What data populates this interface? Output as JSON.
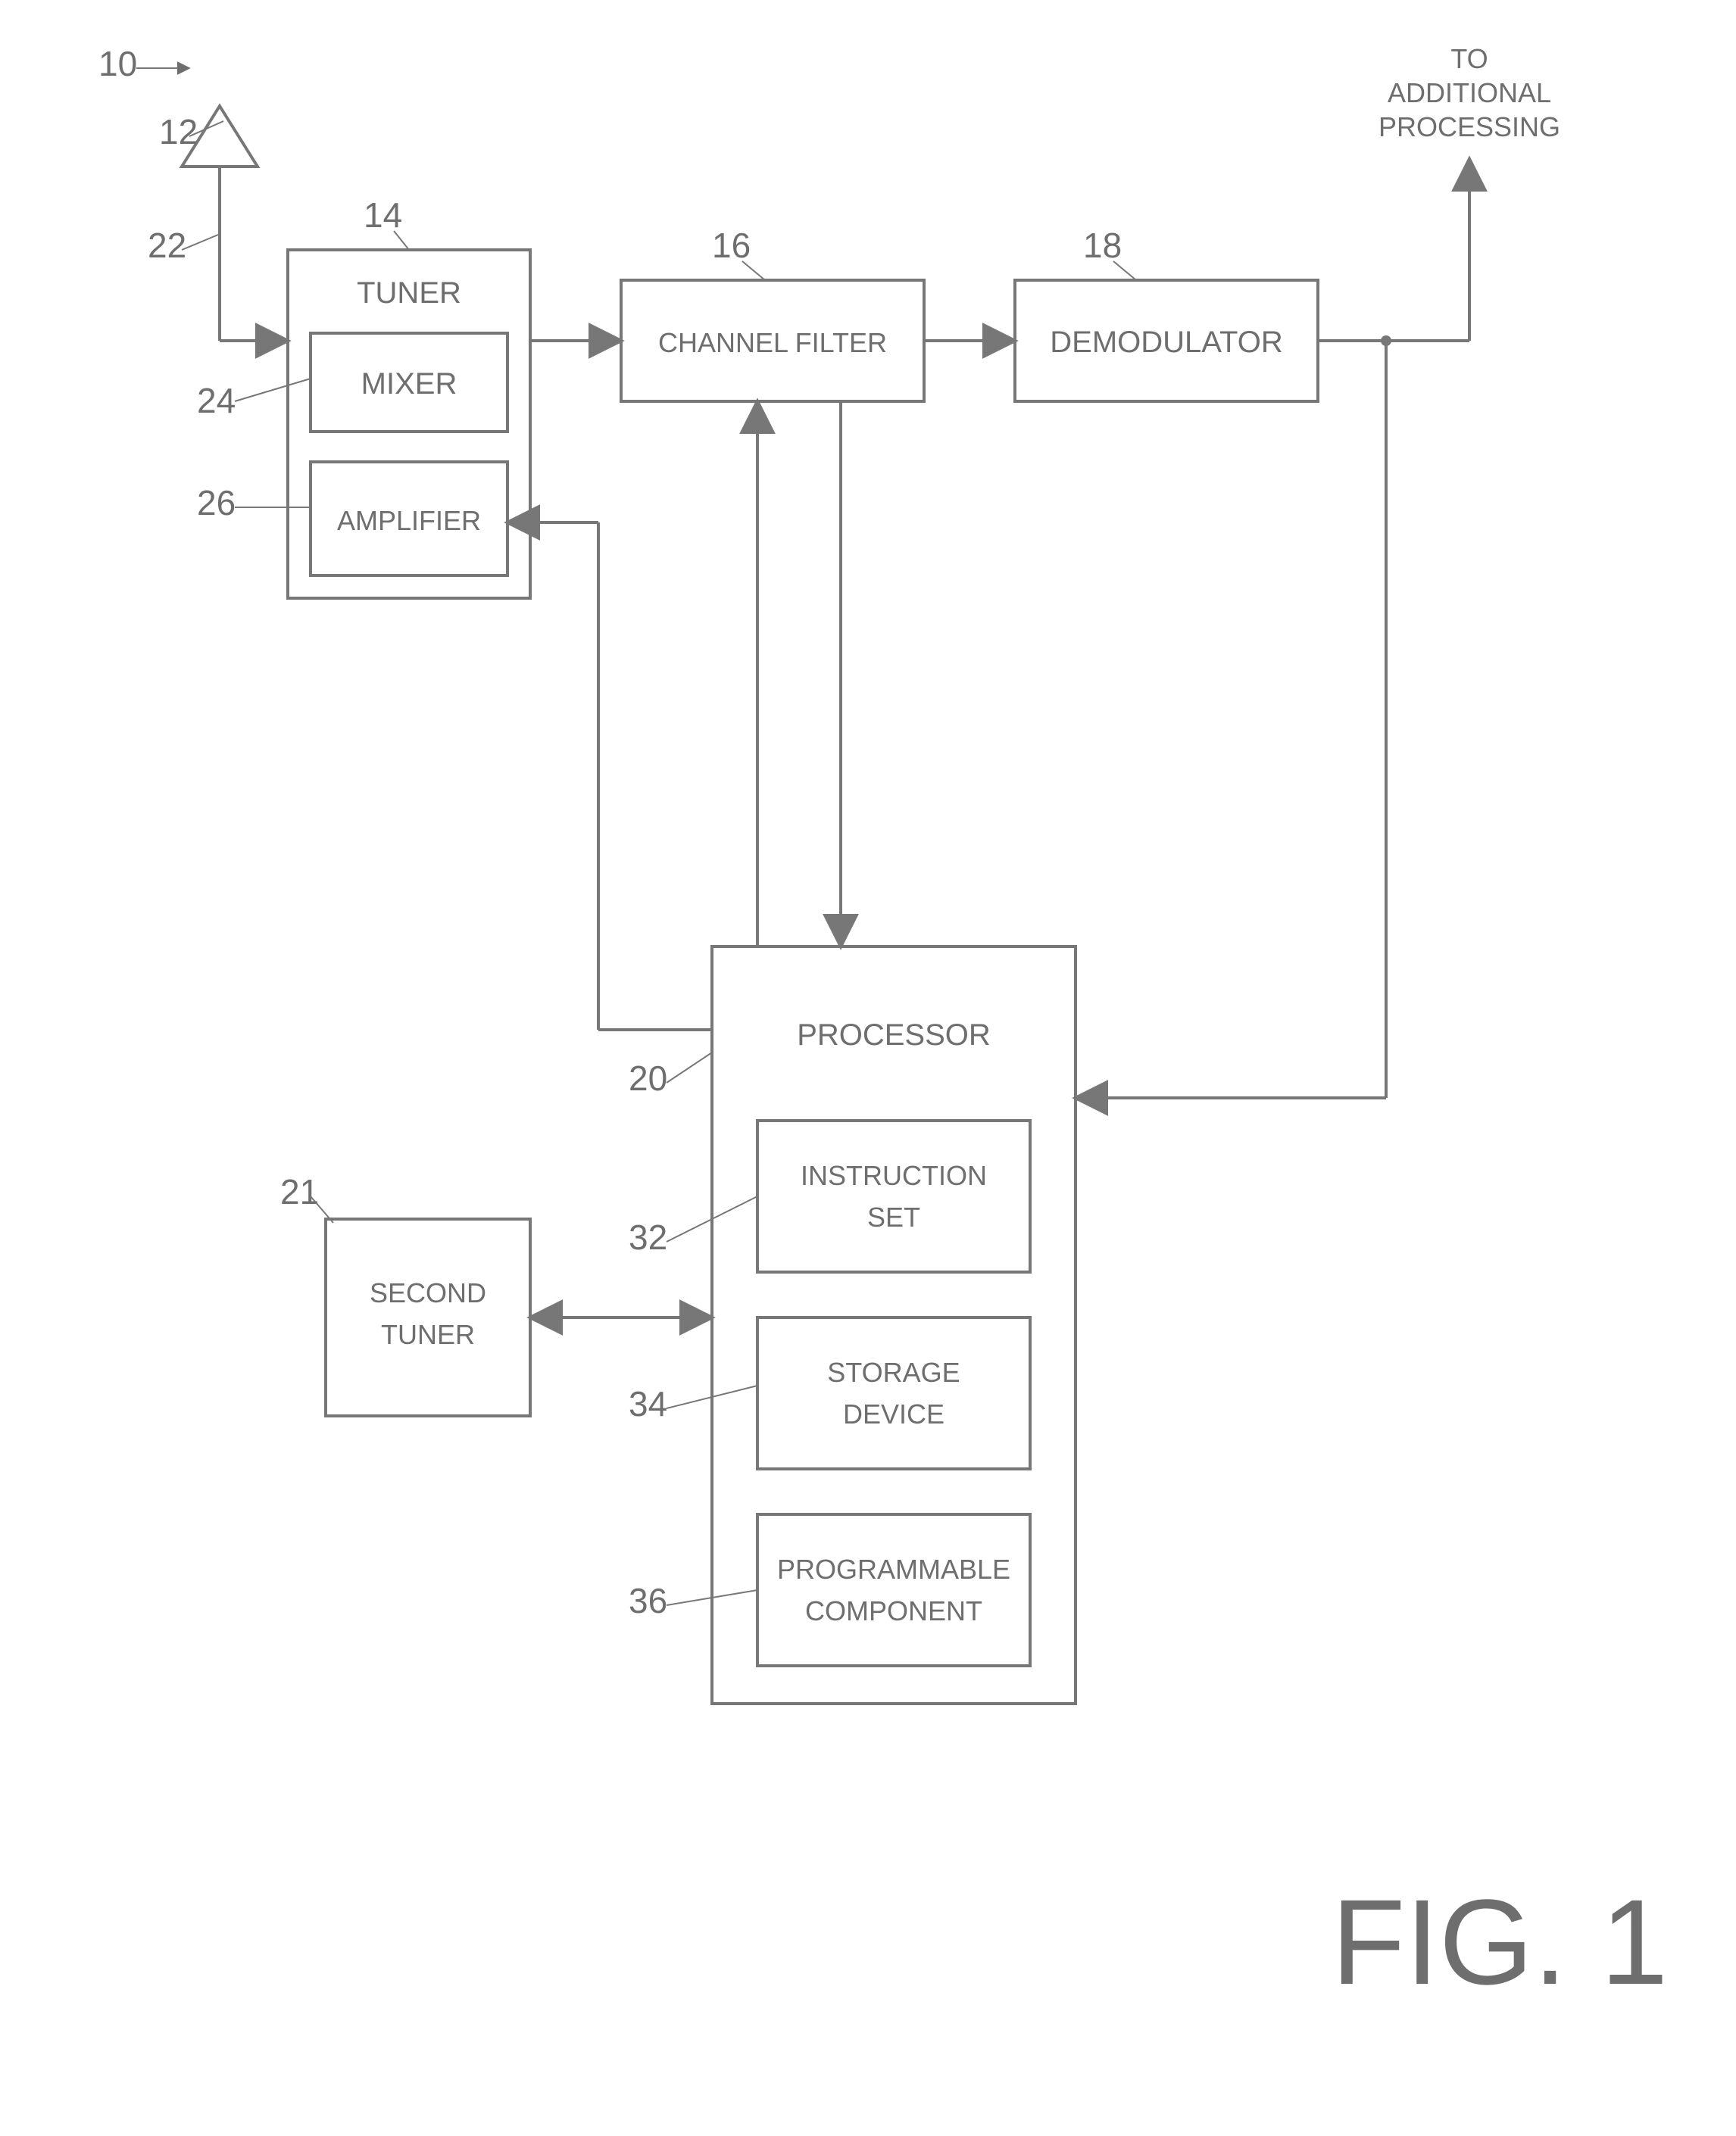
{
  "figure_label": "FIG. 1",
  "output_label_line1": "TO",
  "output_label_line2": "ADDITIONAL",
  "output_label_line3": "PROCESSING",
  "blocks": {
    "tuner": "TUNER",
    "mixer": "MIXER",
    "amplifier": "AMPLIFIER",
    "channel_filter": "CHANNEL FILTER",
    "demodulator": "DEMODULATOR",
    "processor": "PROCESSOR",
    "instruction_set_line1": "INSTRUCTION",
    "instruction_set_line2": "SET",
    "storage_line1": "STORAGE",
    "storage_line2": "DEVICE",
    "programmable_line1": "PROGRAMMABLE",
    "programmable_line2": "COMPONENT",
    "second_tuner_line1": "SECOND",
    "second_tuner_line2": "TUNER"
  },
  "refs": {
    "r10": "10",
    "r12": "12",
    "r14": "14",
    "r16": "16",
    "r18": "18",
    "r20": "20",
    "r21": "21",
    "r22": "22",
    "r24": "24",
    "r26": "26",
    "r32": "32",
    "r34": "34",
    "r36": "36"
  },
  "chart_data": {
    "type": "block-diagram",
    "nodes": [
      {
        "id": 10,
        "label": "(overall system)"
      },
      {
        "id": 12,
        "label": "(antenna)"
      },
      {
        "id": 14,
        "label": "TUNER",
        "contains": [
          24,
          26
        ]
      },
      {
        "id": 24,
        "label": "MIXER"
      },
      {
        "id": 26,
        "label": "AMPLIFIER"
      },
      {
        "id": 16,
        "label": "CHANNEL FILTER"
      },
      {
        "id": 18,
        "label": "DEMODULATOR"
      },
      {
        "id": 20,
        "label": "PROCESSOR",
        "contains": [
          32,
          34,
          36
        ]
      },
      {
        "id": 32,
        "label": "INSTRUCTION SET"
      },
      {
        "id": 34,
        "label": "STORAGE DEVICE"
      },
      {
        "id": 36,
        "label": "PROGRAMMABLE COMPONENT"
      },
      {
        "id": 21,
        "label": "SECOND TUNER"
      },
      {
        "id": "out",
        "label": "TO ADDITIONAL PROCESSING"
      }
    ],
    "edges": [
      {
        "from": 12,
        "to": 14,
        "dir": "uni"
      },
      {
        "from": 14,
        "to": 16,
        "dir": "uni"
      },
      {
        "from": 16,
        "to": 18,
        "dir": "uni"
      },
      {
        "from": 18,
        "to": "out",
        "dir": "uni"
      },
      {
        "from": 16,
        "to": 20,
        "dir": "bi"
      },
      {
        "from": 18,
        "to": 20,
        "dir": "uni",
        "note": "tap from demodulator output"
      },
      {
        "from": 20,
        "to": 26,
        "dir": "uni"
      },
      {
        "from": 20,
        "to": 21,
        "dir": "bi"
      }
    ]
  }
}
